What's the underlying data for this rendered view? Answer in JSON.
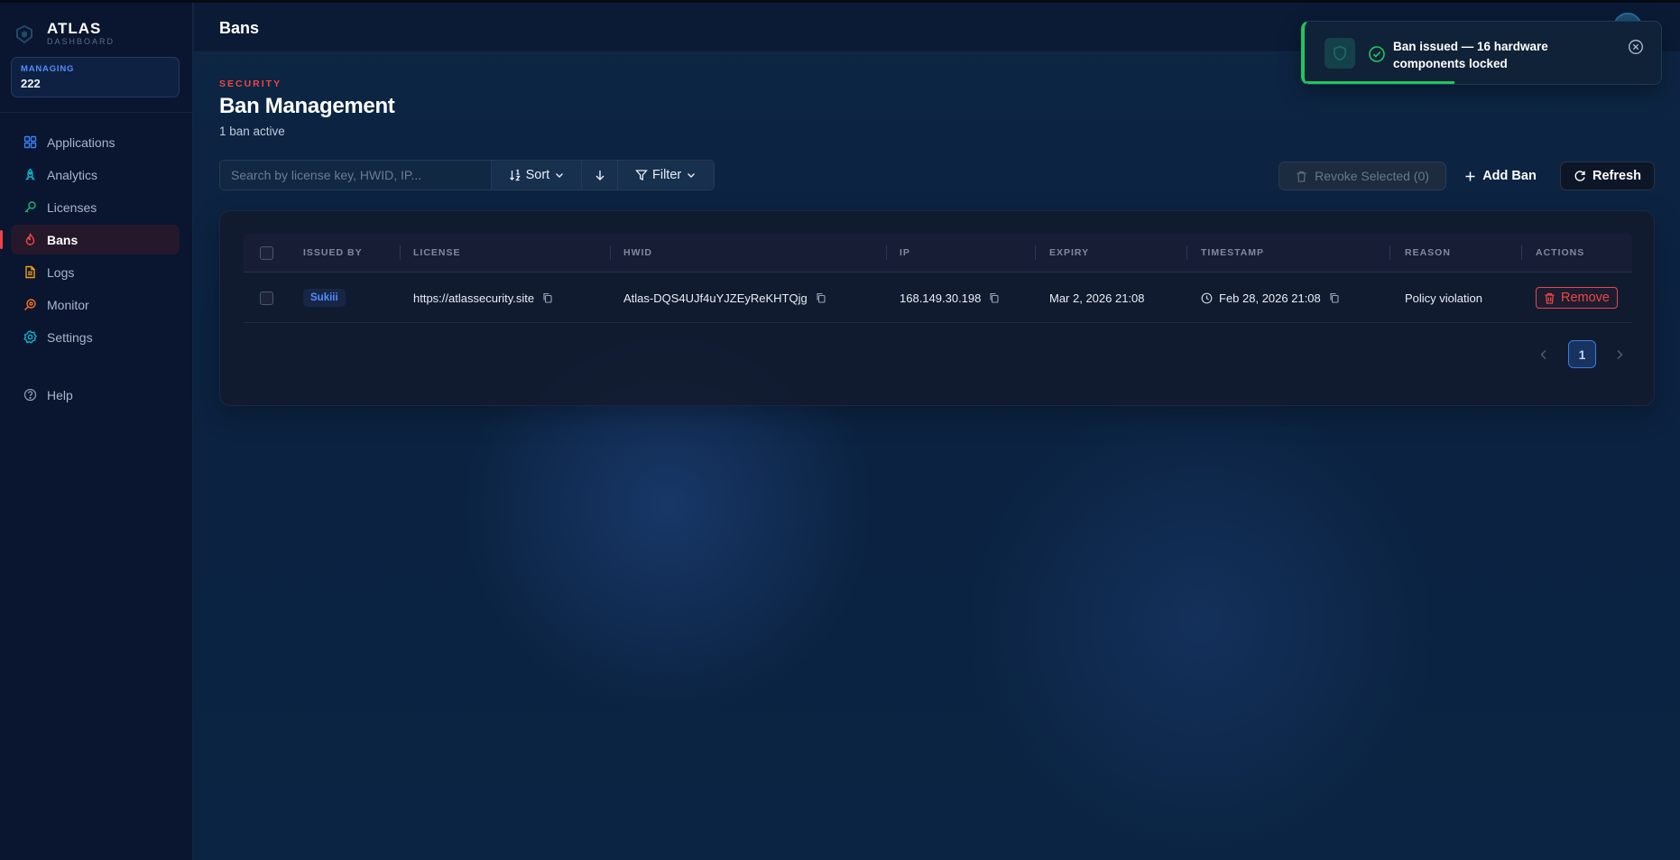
{
  "brand": {
    "name": "ATLAS",
    "subtitle": "DASHBOARD"
  },
  "managing": {
    "label": "MANAGING",
    "value": "222"
  },
  "sidebar": {
    "items": [
      {
        "label": "Applications",
        "icon": "grid-icon",
        "color": "#3b82f6"
      },
      {
        "label": "Analytics",
        "icon": "rocket-icon",
        "color": "#06b6d4"
      },
      {
        "label": "Licenses",
        "icon": "key-icon",
        "color": "#10b981"
      },
      {
        "label": "Bans",
        "icon": "flame-icon",
        "color": "#ef4444",
        "active": true
      },
      {
        "label": "Logs",
        "icon": "file-icon",
        "color": "#f59e0b"
      },
      {
        "label": "Monitor",
        "icon": "radar-icon",
        "color": "#f97316"
      },
      {
        "label": "Settings",
        "icon": "gear-icon",
        "color": "#06b6d4"
      }
    ],
    "help": {
      "label": "Help",
      "icon": "help-circle-icon"
    }
  },
  "header": {
    "title": "Bans"
  },
  "toast": {
    "message": "Ban issued — 16 hardware components locked",
    "accent": "#22c55e",
    "progress": 0.42
  },
  "page": {
    "section": "SECURITY",
    "title": "Ban Management",
    "subtitle": "1 ban active"
  },
  "toolbar": {
    "search_placeholder": "Search by license key, HWID, IP...",
    "sort_label": "Sort",
    "filter_label": "Filter",
    "revoke_label": "Revoke Selected (0)",
    "add_label": "Add Ban",
    "refresh_label": "Refresh"
  },
  "table": {
    "columns": [
      "ISSUED BY",
      "LICENSE",
      "HWID",
      "IP",
      "EXPIRY",
      "TIMESTAMP",
      "REASON",
      "ACTIONS"
    ],
    "rows": [
      {
        "issued_by": "Sukiii",
        "license": "https://atlassecurity.site",
        "hwid": "Atlas-DQS4UJf4uYJZEyReKHTQjg",
        "ip": "168.149.30.198",
        "expiry": "Mar 2, 2026 21:08",
        "timestamp": "Feb 28, 2026 21:08",
        "reason": "Policy violation",
        "action_label": "Remove"
      }
    ]
  },
  "pagination": {
    "current": "1"
  },
  "colors": {
    "accent_blue": "#4f8dff",
    "danger": "#ef4444",
    "success": "#22c55e"
  }
}
